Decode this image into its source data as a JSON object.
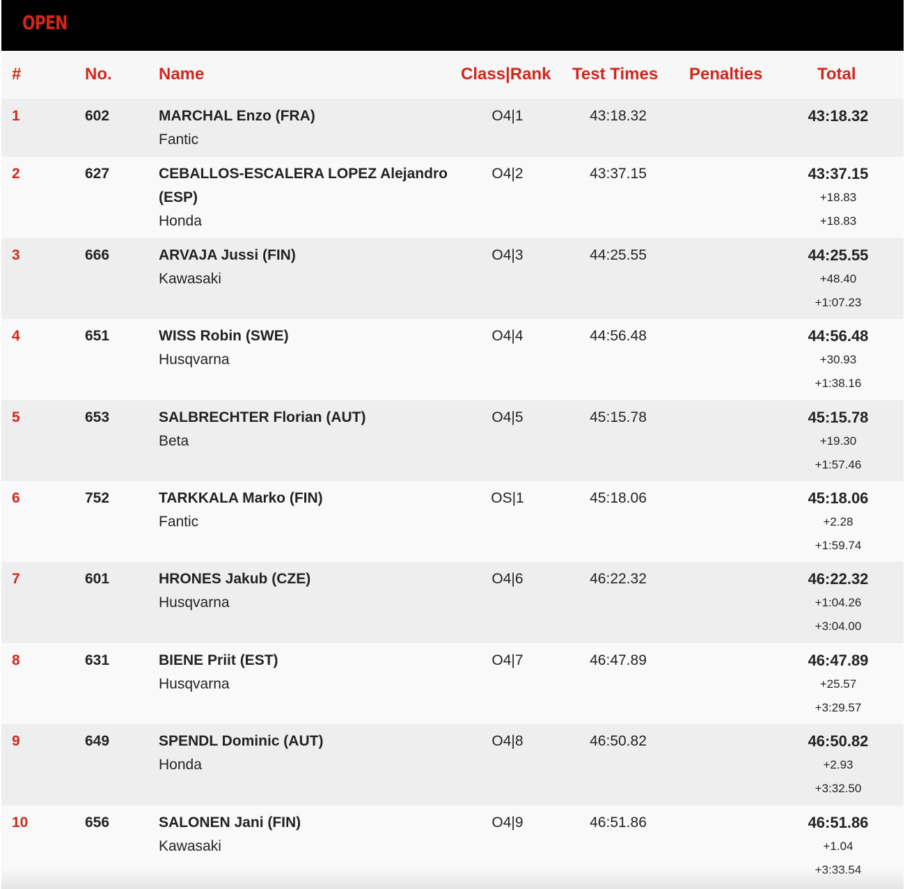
{
  "banner": {
    "title": "OPEN"
  },
  "columns": {
    "pos": "#",
    "no": "No.",
    "name": "Name",
    "class_rank": "Class|Rank",
    "test_times": "Test Times",
    "penalties": "Penalties",
    "total": "Total"
  },
  "rows": [
    {
      "pos": "1",
      "no": "602",
      "rider": "MARCHAL Enzo (FRA)",
      "team": "Fantic",
      "class_rank": "O4|1",
      "test_time": "43:18.32",
      "penalty": "",
      "total": "43:18.32",
      "gap_prev": "",
      "gap_leader": ""
    },
    {
      "pos": "2",
      "no": "627",
      "rider": "CEBALLOS-ESCALERA LOPEZ Alejandro (ESP)",
      "team": "Honda",
      "class_rank": "O4|2",
      "test_time": "43:37.15",
      "penalty": "",
      "total": "43:37.15",
      "gap_prev": "+18.83",
      "gap_leader": "+18.83"
    },
    {
      "pos": "3",
      "no": "666",
      "rider": "ARVAJA Jussi (FIN)",
      "team": "Kawasaki",
      "class_rank": "O4|3",
      "test_time": "44:25.55",
      "penalty": "",
      "total": "44:25.55",
      "gap_prev": "+48.40",
      "gap_leader": "+1:07.23"
    },
    {
      "pos": "4",
      "no": "651",
      "rider": "WISS Robin (SWE)",
      "team": "Husqvarna",
      "class_rank": "O4|4",
      "test_time": "44:56.48",
      "penalty": "",
      "total": "44:56.48",
      "gap_prev": "+30.93",
      "gap_leader": "+1:38.16"
    },
    {
      "pos": "5",
      "no": "653",
      "rider": "SALBRECHTER Florian (AUT)",
      "team": "Beta",
      "class_rank": "O4|5",
      "test_time": "45:15.78",
      "penalty": "",
      "total": "45:15.78",
      "gap_prev": "+19.30",
      "gap_leader": "+1:57.46"
    },
    {
      "pos": "6",
      "no": "752",
      "rider": "TARKKALA Marko (FIN)",
      "team": "Fantic",
      "class_rank": "OS|1",
      "test_time": "45:18.06",
      "penalty": "",
      "total": "45:18.06",
      "gap_prev": "+2.28",
      "gap_leader": "+1:59.74"
    },
    {
      "pos": "7",
      "no": "601",
      "rider": "HRONES Jakub (CZE)",
      "team": "Husqvarna",
      "class_rank": "O4|6",
      "test_time": "46:22.32",
      "penalty": "",
      "total": "46:22.32",
      "gap_prev": "+1:04.26",
      "gap_leader": "+3:04.00"
    },
    {
      "pos": "8",
      "no": "631",
      "rider": "BIENE Priit (EST)",
      "team": "Husqvarna",
      "class_rank": "O4|7",
      "test_time": "46:47.89",
      "penalty": "",
      "total": "46:47.89",
      "gap_prev": "+25.57",
      "gap_leader": "+3:29.57"
    },
    {
      "pos": "9",
      "no": "649",
      "rider": "SPENDL Dominic (AUT)",
      "team": "Honda",
      "class_rank": "O4|8",
      "test_time": "46:50.82",
      "penalty": "",
      "total": "46:50.82",
      "gap_prev": "+2.93",
      "gap_leader": "+3:32.50"
    },
    {
      "pos": "10",
      "no": "656",
      "rider": "SALONEN Jani (FIN)",
      "team": "Kawasaki",
      "class_rank": "O4|9",
      "test_time": "46:51.86",
      "penalty": "",
      "total": "46:51.86",
      "gap_prev": "+1.04",
      "gap_leader": "+3:33.54"
    }
  ]
}
